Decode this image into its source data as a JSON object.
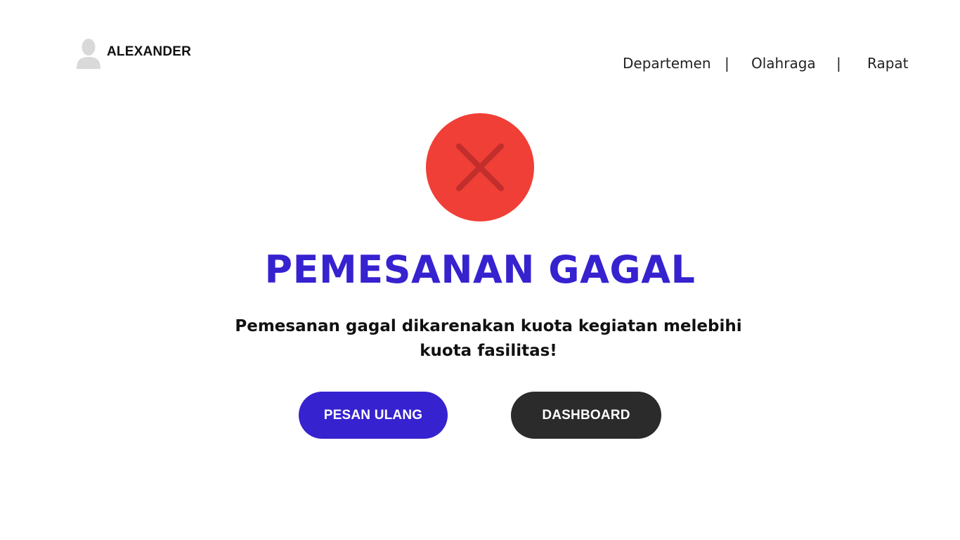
{
  "user": {
    "name": "ALEXANDER",
    "avatar_icon": "user-avatar-icon"
  },
  "nav": {
    "items": [
      {
        "label": "Departemen"
      },
      {
        "label": "Olahraga"
      },
      {
        "label": "Rapat"
      }
    ],
    "separator": "|"
  },
  "status": {
    "icon": "close-circle-icon",
    "title": "PEMESANAN GAGAL",
    "message": "Pemesanan gagal dikarenakan kuota kegiatan melebihi kuota fasilitas!"
  },
  "actions": {
    "retry_label": "PESAN ULANG",
    "dashboard_label": "DASHBOARD"
  },
  "colors": {
    "primary": "#3622CF",
    "error": "#F03F36",
    "error_mark": "#C12E2B",
    "dark": "#2B2B2B"
  }
}
